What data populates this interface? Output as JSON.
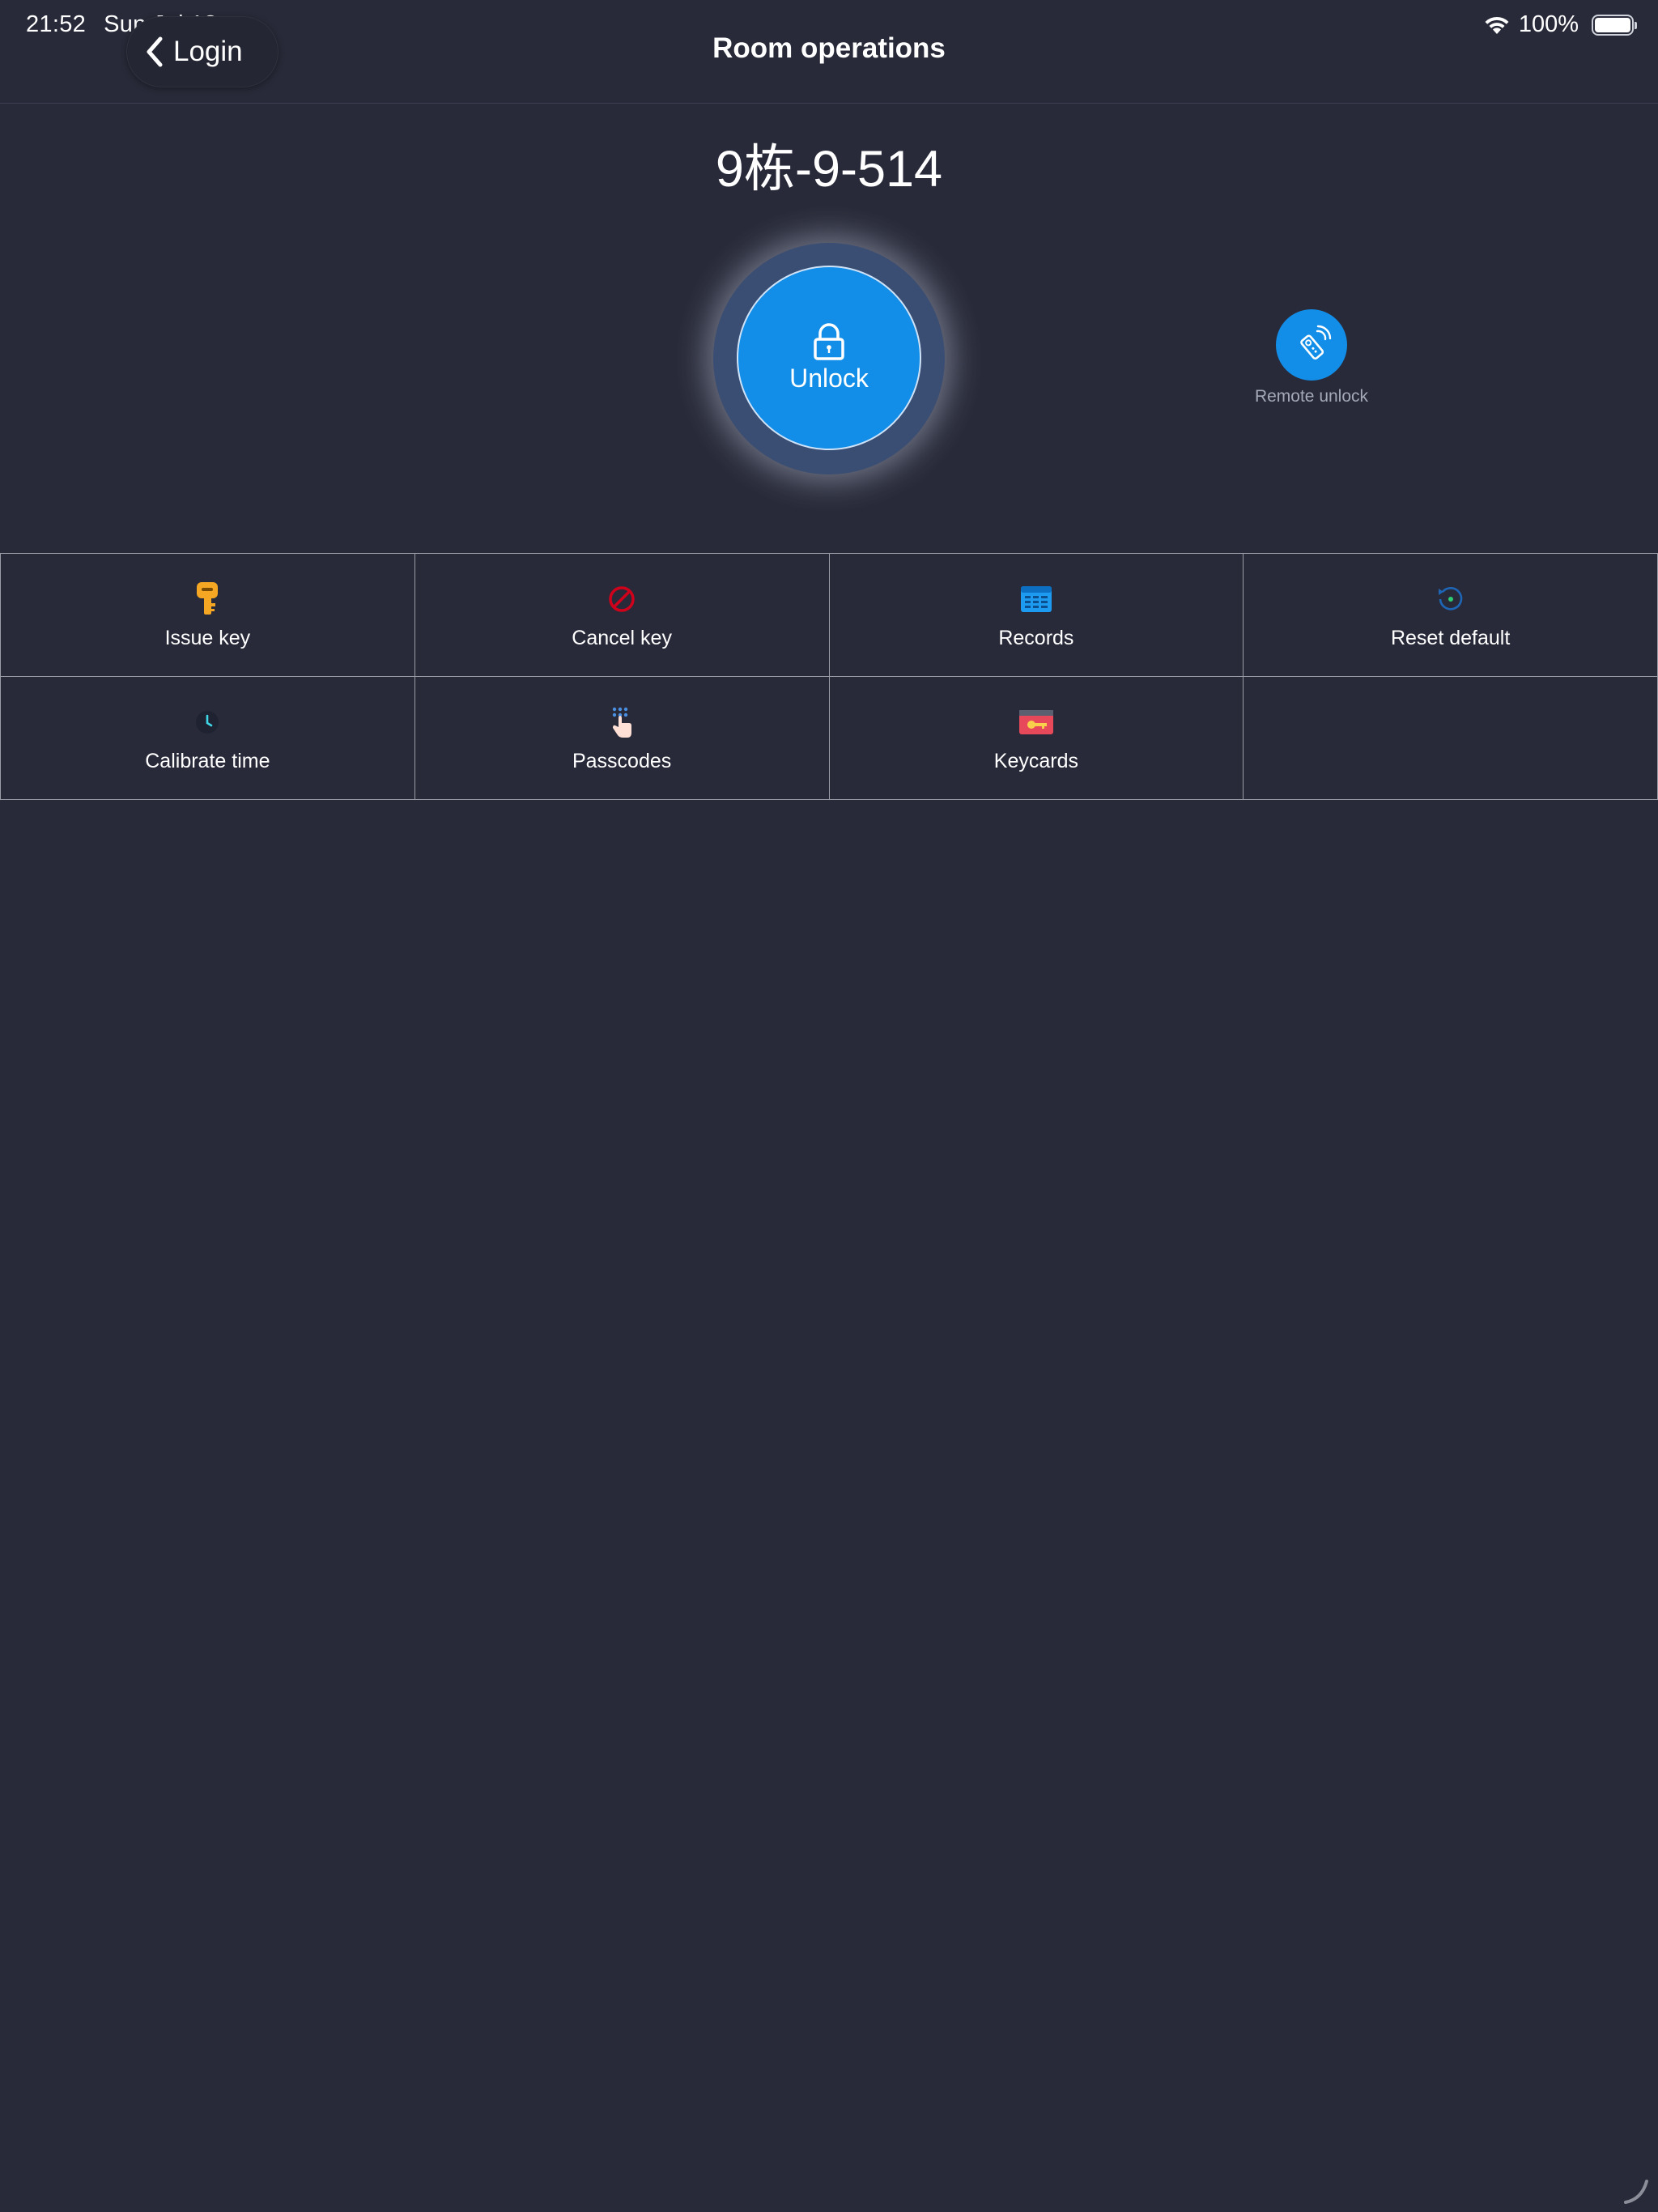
{
  "status_bar": {
    "time": "21:52",
    "date": "Sun Jul 12",
    "battery_text": "100%",
    "battery_level": 1.0
  },
  "nav": {
    "back_label": "Login",
    "title": "Room operations"
  },
  "room": {
    "name": "9栋-9-514"
  },
  "actions": {
    "unlock_label": "Unlock",
    "remote_unlock_label": "Remote unlock"
  },
  "grid": {
    "items": [
      {
        "label": "Issue key",
        "icon": "key-icon"
      },
      {
        "label": "Cancel key",
        "icon": "prohibited-icon"
      },
      {
        "label": "Records",
        "icon": "records-calendar-icon"
      },
      {
        "label": "Reset default",
        "icon": "reset-icon"
      },
      {
        "label": "Calibrate time",
        "icon": "clock-icon"
      },
      {
        "label": "Passcodes",
        "icon": "keypad-finger-icon"
      },
      {
        "label": "Keycards",
        "icon": "keycard-icon"
      }
    ]
  },
  "colors": {
    "background": "#282a39",
    "accent": "#138ee8",
    "grid_line": "#9a9ca6",
    "key_orange": "#f5a623",
    "cancel_red": "#d0021b",
    "keycard_red": "#e8495a"
  }
}
